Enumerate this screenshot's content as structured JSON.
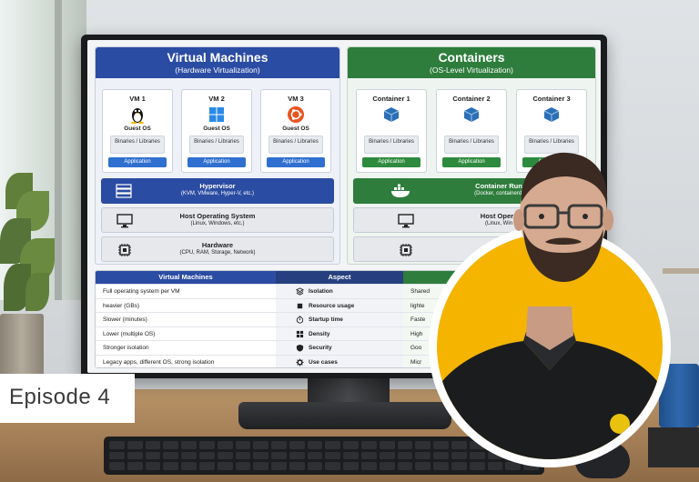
{
  "episode_label": "Episode 4",
  "vm_section": {
    "title": "Virtual Machines",
    "subtitle": "(Hardware Virtualization)",
    "cards": [
      {
        "name": "VM 1",
        "os_icon": "linux-tux-icon",
        "guest": "Guest OS",
        "bins": "Binaries / Libraries",
        "app": "Application"
      },
      {
        "name": "VM 2",
        "os_icon": "windows-logo-icon",
        "guest": "Guest OS",
        "bins": "Binaries / Libraries",
        "app": "Application"
      },
      {
        "name": "VM 3",
        "os_icon": "ubuntu-logo-icon",
        "guest": "Guest OS",
        "bins": "Binaries / Libraries",
        "app": "Application"
      }
    ],
    "hypervisor": {
      "title": "Hypervisor",
      "sub": "(KVM, VMware, Hyper-V, etc.)"
    },
    "host": {
      "title": "Host Operating System",
      "sub": "(Linux, Windows, etc.)"
    },
    "hardware": {
      "title": "Hardware",
      "sub": "(CPU, RAM, Storage, Network)"
    }
  },
  "container_section": {
    "title": "Containers",
    "subtitle": "(OS-Level Virtualization)",
    "cards": [
      {
        "name": "Container 1",
        "bins": "Binaries / Libraries",
        "app": "Application"
      },
      {
        "name": "Container 2",
        "bins": "Binaries / Libraries",
        "app": "Application"
      },
      {
        "name": "Container 3",
        "bins": "Binaries / Libraries",
        "app": "Application"
      }
    ],
    "runtime": {
      "title": "Container Run",
      "sub": "(Docker, containerd,"
    },
    "host": {
      "title": "Host Opera",
      "sub": "(Linux, Win"
    },
    "hardware": {
      "title": "Har",
      "sub": "(CPU"
    }
  },
  "table": {
    "headers": {
      "vm": "Virtual Machines",
      "aspect": "Aspect",
      "ct": "Containers"
    },
    "rows": [
      {
        "vm": "Full operating system per VM",
        "aspect": "Isolation",
        "ct": "Shared"
      },
      {
        "vm": "heavier (GBs)",
        "aspect": "Resource usage",
        "ct": "lighte"
      },
      {
        "vm": "Slower (minutes)",
        "aspect": "Startup time",
        "ct": "Faste"
      },
      {
        "vm": "Lower (multiple OS)",
        "aspect": "Density",
        "ct": "High"
      },
      {
        "vm": "Stronger isolation",
        "aspect": "Security",
        "ct": "Goo"
      },
      {
        "vm": "Legacy apps, different OS, strong isolation",
        "aspect": "Use cases",
        "ct": "Micr"
      }
    ]
  },
  "colors": {
    "vm_blue": "#2b4ca3",
    "container_green": "#2e7d3c",
    "badge_yellow": "#f4b400"
  }
}
